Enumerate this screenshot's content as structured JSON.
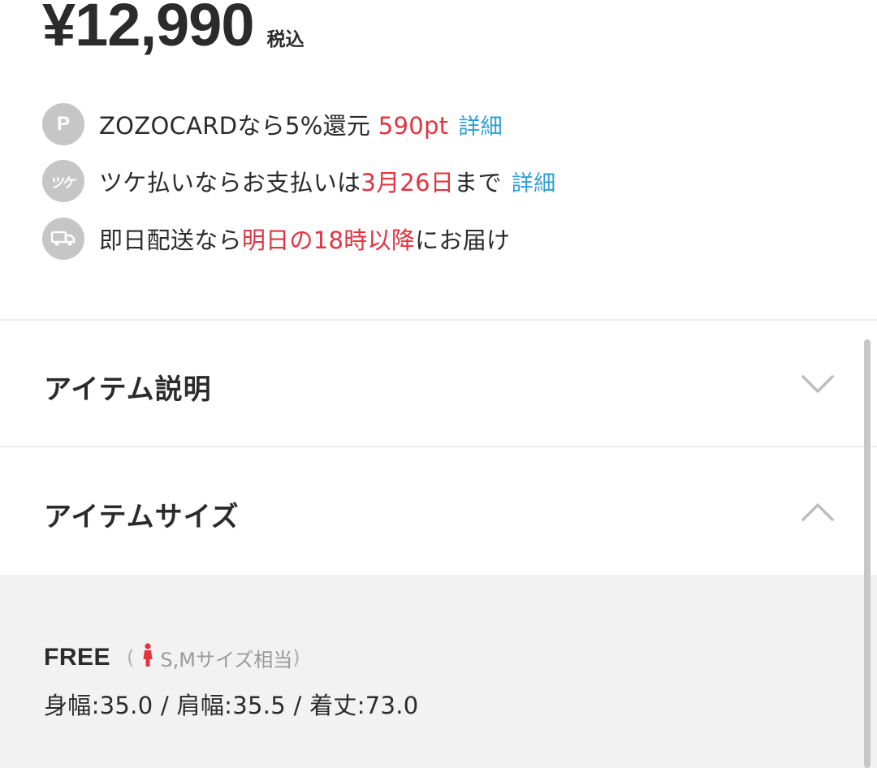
{
  "price": {
    "amount": "¥12,990",
    "tax_label": "税込"
  },
  "benefits": [
    {
      "icon": "point-p-icon",
      "icon_glyph": "P",
      "text_before": "ZOZOCARDなら5%還元 ",
      "highlight": "590pt",
      "text_after": "",
      "link": "詳細"
    },
    {
      "icon": "tsuke-payment-icon",
      "icon_glyph": "ツケ",
      "text_before": "ツケ払いならお支払いは",
      "highlight": "3月26日",
      "text_after": "まで",
      "link": "詳細"
    },
    {
      "icon": "delivery-truck-icon",
      "text_before": "即日配送なら",
      "highlight": "明日の18時以降",
      "text_after": "にお届け"
    }
  ],
  "sections": {
    "description": {
      "title": "アイテム説明",
      "state": "collapsed"
    },
    "size": {
      "title": "アイテムサイズ",
      "state": "expanded",
      "size_name": "FREE",
      "paren_open": "(",
      "paren_close": ")",
      "equivalent": "S,Mサイズ相当",
      "measurements": "身幅:35.0 / 肩幅:35.5 / 着丈:73.0"
    }
  },
  "colors": {
    "accent_red": "#e5333f",
    "link_blue": "#2e9fd4",
    "icon_gray": "#c6c6c6",
    "panel_bg": "#f2f2f2",
    "woman_icon": "#e5333f"
  }
}
